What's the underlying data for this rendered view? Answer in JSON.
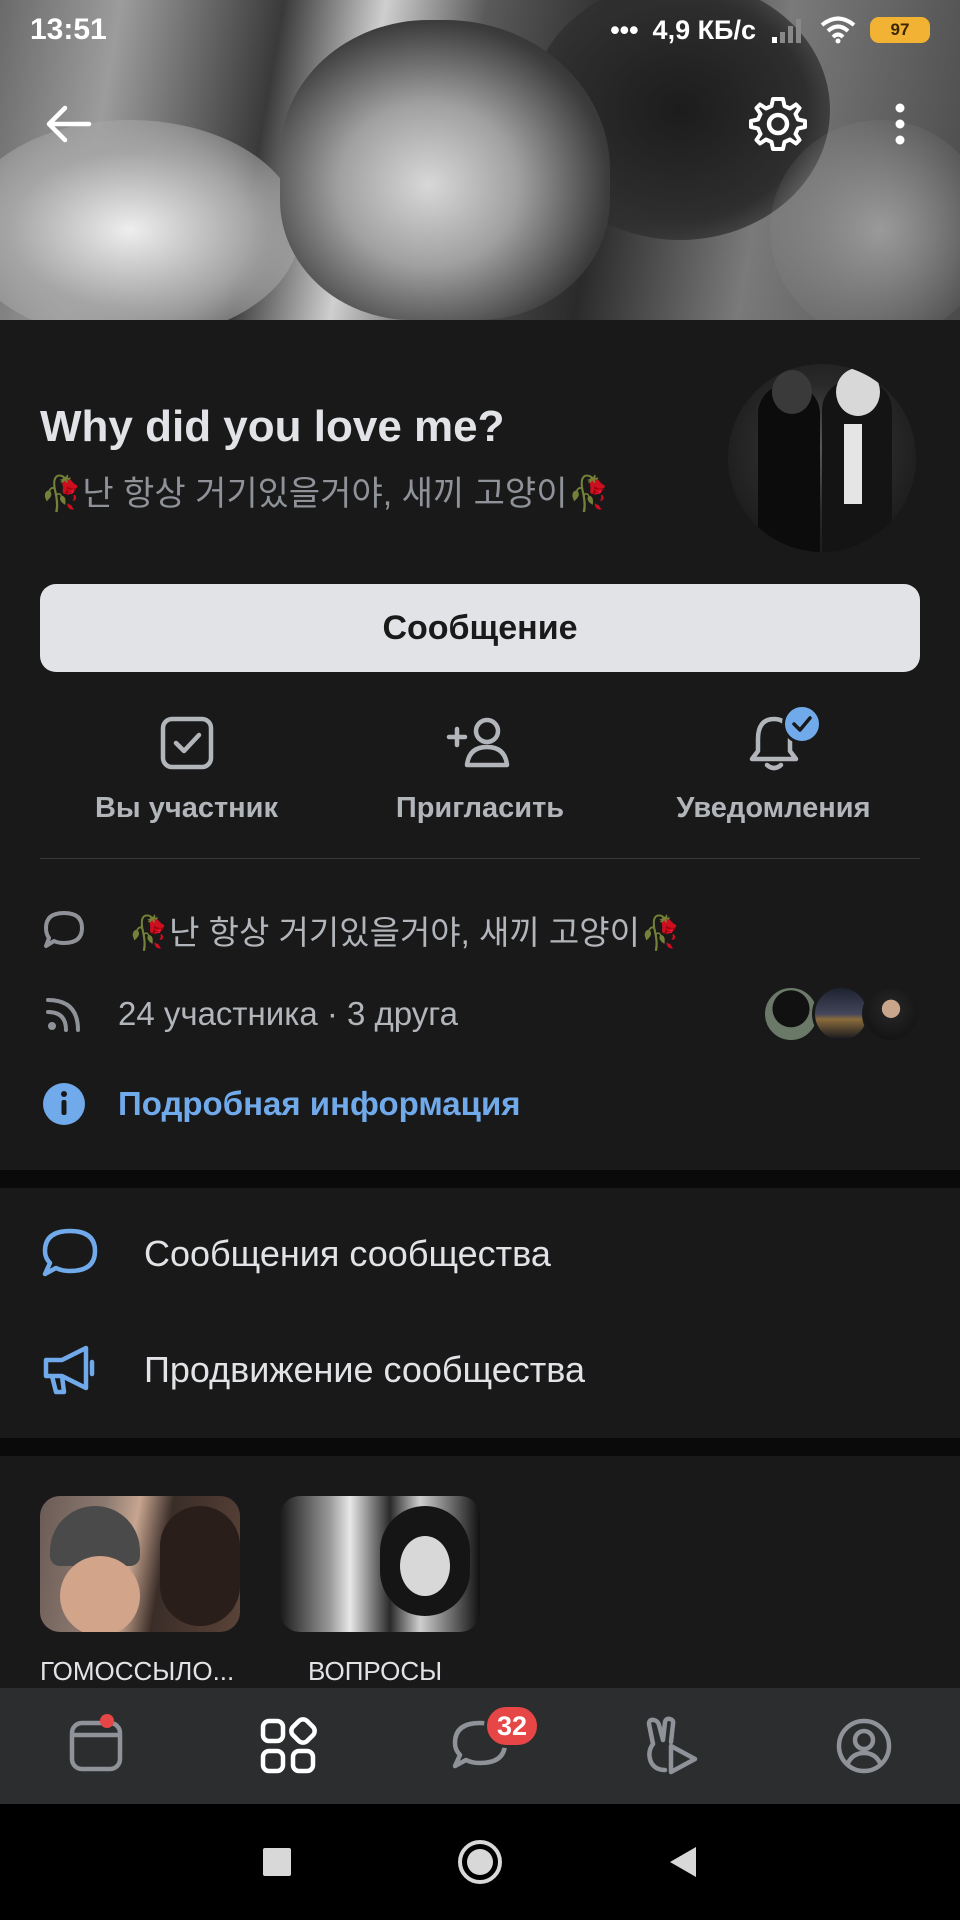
{
  "status_bar": {
    "time": "13:51",
    "network_speed": "4,9 КБ/с",
    "battery": "97"
  },
  "community": {
    "title": "Why did you love me?",
    "subtitle": "🥀난 항상 거기있을거야, 새끼 고양이🥀",
    "message_button": "Сообщение"
  },
  "actions": [
    {
      "label": "Вы участник",
      "icon": "checkbox-icon"
    },
    {
      "label": "Пригласить",
      "icon": "add-user-icon"
    },
    {
      "label": "Уведомления",
      "icon": "bell-icon"
    }
  ],
  "info": {
    "status_text": "🥀난 항상 거기있을거야, 새끼 고양이🥀",
    "members_text": "24 участника · 3 друга",
    "details_link": "Подробная информация"
  },
  "menu": [
    {
      "label": "Сообщения сообщества",
      "icon": "chat-bubble-icon"
    },
    {
      "label": "Продвижение сообщества",
      "icon": "megaphone-icon"
    }
  ],
  "tiles": [
    {
      "label": "ГОМОССЫЛО..."
    },
    {
      "label": "ВОПРОСЫ"
    }
  ],
  "tabbar": {
    "messages_badge": "32"
  },
  "colors": {
    "accent": "#71aaeb",
    "background": "#19191a",
    "badge": "#e64646",
    "battery": "#f2b233"
  }
}
